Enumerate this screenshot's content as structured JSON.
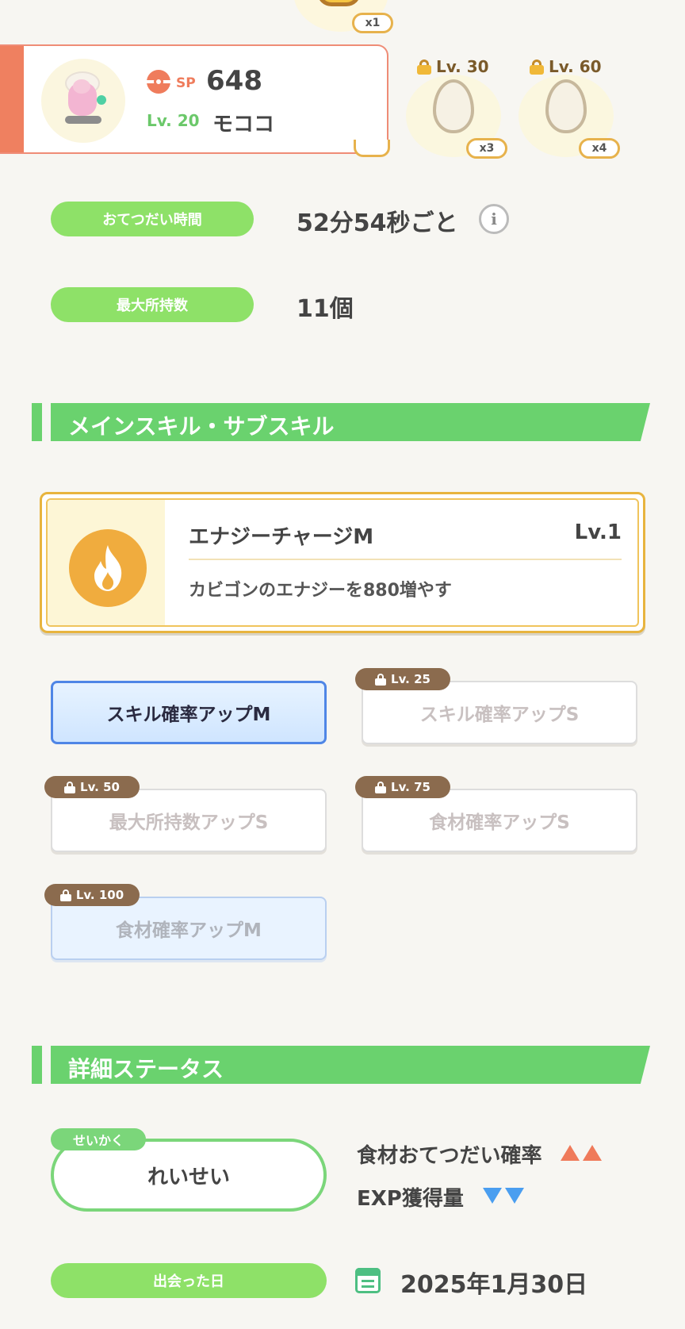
{
  "top": {
    "ingredient_count": "x1"
  },
  "pokemon": {
    "sp_label": "SP",
    "sp_value": "648",
    "level": "Lv. 20",
    "name": "モココ"
  },
  "eggs": [
    {
      "unlock_level": "Lv. 30",
      "count": "x3"
    },
    {
      "unlock_level": "Lv. 60",
      "count": "x4"
    }
  ],
  "info_rows": [
    {
      "label": "おてつだい時間",
      "value": "52分54秒ごと"
    },
    {
      "label": "最大所持数",
      "value": "11個"
    }
  ],
  "section_skills": {
    "title": "メインスキル・サブスキル"
  },
  "main_skill": {
    "name": "エナジーチャージM",
    "level": "Lv.1",
    "description": "カビゴンのエナジーを880増やす"
  },
  "sub_skills": [
    {
      "label": "スキル確率アップM",
      "state": "active",
      "unlock": ""
    },
    {
      "label": "スキル確率アップS",
      "state": "locked",
      "unlock": "Lv. 25"
    },
    {
      "label": "最大所持数アップS",
      "state": "locked",
      "unlock": "Lv. 50"
    },
    {
      "label": "食材確率アップS",
      "state": "locked",
      "unlock": "Lv. 75"
    },
    {
      "label": "食材確率アップM",
      "state": "locked-blue",
      "unlock": "Lv. 100"
    }
  ],
  "section_status": {
    "title": "詳細ステータス"
  },
  "nature": {
    "tag": "せいかく",
    "value": "れいせい",
    "effects": [
      {
        "label": "食材おてつだい確率",
        "direction": "up"
      },
      {
        "label": "EXP獲得量",
        "direction": "down"
      }
    ]
  },
  "met_date": {
    "label": "出会った日",
    "value": "2025年1月30日"
  },
  "colors": {
    "green": "#6ad26e",
    "accent_orange": "#ef7c5c",
    "gold": "#e8b43e",
    "blue": "#4f86e6",
    "brown_badge": "#8b6b4e"
  }
}
